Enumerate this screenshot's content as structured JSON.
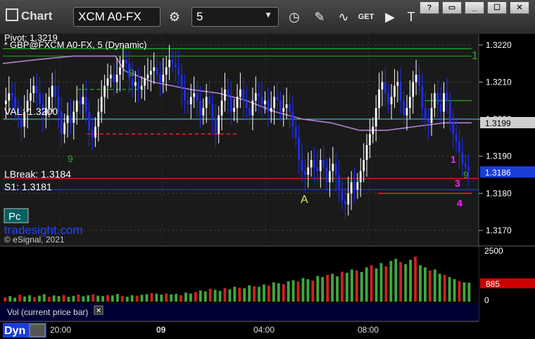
{
  "toolbar": {
    "title": "Chart",
    "symbol": "XCM A0-FX",
    "interval": "5",
    "icons": [
      "settings-gear-icon",
      "clock-icon",
      "pencil-icon",
      "studies-icon",
      "get-icon",
      "play-icon",
      "text-icon"
    ],
    "window_buttons": [
      "?",
      "restore",
      "_",
      "maximize",
      "x"
    ]
  },
  "overlay": {
    "pivot_label": "Pivot: 1.3219",
    "symbol_line": "GBP@FXCM A0-FX, 5 (Dynamic)",
    "val_label": "VAL: 1.3200",
    "lbreak_label": "LBreak: 1.3184",
    "s1_label": "S1: 1.3181",
    "pc_button": "Pc",
    "watermark": "tradesight.com",
    "copyright": "© eSignal, 2021",
    "marker_a": "A",
    "marker_1": "1",
    "marker_3": "3",
    "marker_4": "4",
    "count_green": "1",
    "count_9a": "9",
    "count_9b": "9",
    "count_9c": "9"
  },
  "price_axis": {
    "ticks": [
      "1.3220",
      "1.3210",
      "1.3200",
      "1.3190",
      "1.3180",
      "1.3170"
    ],
    "badge_1": "1.3199",
    "badge_2": "1.3186"
  },
  "volume_pane": {
    "label": "Vol (current price bar)",
    "ticks": [
      "2500",
      "0"
    ],
    "current": "885"
  },
  "time_axis": {
    "labels": [
      "20:00",
      "09",
      "04:00",
      "08:00"
    ],
    "dyn_label": "Dyn"
  },
  "colors": {
    "up": "#ffffff",
    "down": "#1e2dff",
    "ma": "#b07fd6",
    "pivot": "#22aa22",
    "val": "#4dd0e1",
    "support": "#ff2222",
    "volume_up": "#3fa83f",
    "volume_down": "#cc2222",
    "accent_blue": "#1a3dd8"
  },
  "chart_data": {
    "type": "candlestick",
    "symbol": "GBP@FXCM A0-FX",
    "interval": "5",
    "ylim": [
      1.3166,
      1.3223
    ],
    "y_ticks": [
      1.322,
      1.321,
      1.32,
      1.319,
      1.318,
      1.317
    ],
    "x_labels": [
      "20:00",
      "09",
      "04:00",
      "08:00"
    ],
    "price_path": [
      1.3204,
      1.3205,
      1.3207,
      1.3206,
      1.3203,
      1.32,
      1.3198,
      1.3202,
      1.3205,
      1.3207,
      1.3209,
      1.3207,
      1.3204,
      1.3201,
      1.3203,
      1.3206,
      1.3209,
      1.3206,
      1.3202,
      1.3196,
      1.3199,
      1.3201,
      1.3199,
      1.3202,
      1.3205,
      1.3204,
      1.3206,
      1.3202,
      1.3197,
      1.3195,
      1.3198,
      1.3202,
      1.3206,
      1.3209,
      1.3211,
      1.3212,
      1.321,
      1.3212,
      1.3214,
      1.3216,
      1.3215,
      1.3211,
      1.3209,
      1.321,
      1.3208,
      1.3209,
      1.3211,
      1.3212,
      1.3213,
      1.3214,
      1.3212,
      1.321,
      1.3212,
      1.3214,
      1.3216,
      1.3215,
      1.3214,
      1.3212,
      1.3208,
      1.3205,
      1.3204,
      1.3206,
      1.3207,
      1.3205,
      1.3201,
      1.3203,
      1.3206,
      1.3204,
      1.32,
      1.3196,
      1.3201,
      1.3205,
      1.3208,
      1.3206,
      1.3202,
      1.3203,
      1.3206,
      1.3208,
      1.3205,
      1.3203,
      1.3201,
      1.3205,
      1.3207,
      1.3206,
      1.3204,
      1.3205,
      1.3202,
      1.3203,
      1.3206,
      1.3205,
      1.3202,
      1.3203,
      1.3204,
      1.3202,
      1.3198,
      1.3195,
      1.3189,
      1.3186,
      1.3185,
      1.3187,
      1.3189,
      1.3187,
      1.3186,
      1.3189,
      1.3187,
      1.3183,
      1.3186,
      1.3188,
      1.3185,
      1.3181,
      1.3178,
      1.3177,
      1.318,
      1.3183,
      1.3181,
      1.3183,
      1.3186,
      1.3189,
      1.3193,
      1.3196,
      1.3198,
      1.3203,
      1.3208,
      1.321,
      1.3207,
      1.3204,
      1.3206,
      1.3209,
      1.321,
      1.3205,
      1.3201,
      1.3203,
      1.3206,
      1.321,
      1.3212,
      1.3209,
      1.3203,
      1.32,
      1.3199,
      1.3203,
      1.3207,
      1.3204,
      1.3202,
      1.3207,
      1.3205,
      1.3199,
      1.3196,
      1.3194,
      1.3191,
      1.3188,
      1.3187,
      1.3186
    ],
    "moving_average": [
      [
        0,
        1.3215
      ],
      [
        0.07,
        1.3216
      ],
      [
        0.15,
        1.3217
      ],
      [
        0.24,
        1.3217
      ],
      [
        0.26,
        1.3213
      ],
      [
        0.32,
        1.321
      ],
      [
        0.4,
        1.3208
      ],
      [
        0.46,
        1.3207
      ],
      [
        0.52,
        1.3205
      ],
      [
        0.58,
        1.3202
      ],
      [
        0.64,
        1.32
      ],
      [
        0.7,
        1.3199
      ],
      [
        0.76,
        1.3197
      ],
      [
        0.82,
        1.3197
      ],
      [
        0.88,
        1.3198
      ],
      [
        0.94,
        1.3199
      ],
      [
        1,
        1.3199
      ]
    ],
    "levels": {
      "pivot": 1.3219,
      "pivot_secondary": 1.3217,
      "val": 1.32,
      "lbreak": 1.3184,
      "s1": 1.3181
    },
    "segments": {
      "green_dashed": {
        "from": 0.16,
        "to": 0.3,
        "y": 1.3208
      },
      "red_dashed": {
        "from": 0.18,
        "to": 0.5,
        "y": 1.3196
      },
      "green_solid": {
        "from": 0.9,
        "to": 1.0,
        "y": 1.3205
      },
      "red_solid": {
        "from": 0.8,
        "to": 1.0,
        "y": 1.318
      }
    },
    "volume": {
      "ylim": [
        0,
        2500
      ],
      "values": [
        200,
        260,
        180,
        320,
        240,
        300,
        210,
        280,
        350,
        230,
        290,
        260,
        310,
        220,
        270,
        330,
        250,
        300,
        340,
        280,
        260,
        310,
        290,
        360,
        270,
        230,
        300,
        280,
        320,
        350,
        400,
        370,
        330,
        380,
        340,
        360,
        300,
        420,
        380,
        450,
        520,
        480,
        600,
        550,
        500,
        640,
        580,
        700,
        650,
        620,
        760,
        720,
        690,
        800,
        750,
        900,
        860,
        820,
        950,
        1000,
        940,
        1100,
        1050,
        980,
        1200,
        1150,
        1250,
        1300,
        1180,
        1400,
        1350,
        1500,
        1450,
        1380,
        1600,
        1700,
        1550,
        1800,
        1650,
        1900,
        2000,
        1850,
        1750,
        1950,
        2100,
        1700,
        1600,
        1450,
        1500,
        1300,
        1250,
        1150,
        1050,
        950,
        900,
        885
      ]
    }
  }
}
